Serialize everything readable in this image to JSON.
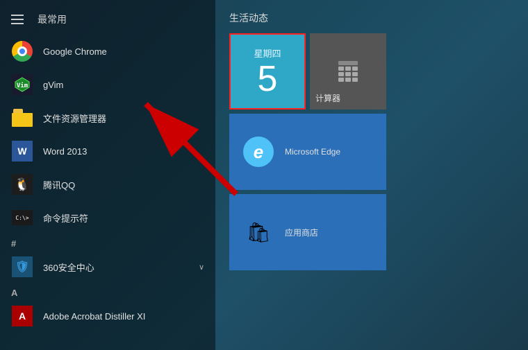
{
  "header": {
    "section_label": "最常用"
  },
  "right": {
    "title": "生活动态"
  },
  "apps": [
    {
      "id": "chrome",
      "label": "Google Chrome",
      "icon_type": "chrome"
    },
    {
      "id": "gvim",
      "label": "gVim",
      "icon_type": "gvim"
    },
    {
      "id": "file-explorer",
      "label": "文件资源管理器",
      "icon_type": "folder"
    },
    {
      "id": "word",
      "label": "Word 2013",
      "icon_type": "word"
    },
    {
      "id": "qq",
      "label": "腾讯QQ",
      "icon_type": "qq"
    },
    {
      "id": "cmd",
      "label": "命令提示符",
      "icon_type": "cmd"
    }
  ],
  "section_hash": "#",
  "apps_hash": [
    {
      "id": "360",
      "label": "360安全中心",
      "icon_type": "360",
      "has_expand": true
    }
  ],
  "section_a": "A",
  "apps_a": [
    {
      "id": "acrobat",
      "label": "Adobe Acrobat Distiller XI",
      "icon_type": "acrobat"
    }
  ],
  "tiles": {
    "calendar": {
      "day_name": "星期四",
      "day_number": "5"
    },
    "calc": {
      "label": "计算器"
    },
    "edge": {
      "label": "Microsoft Edge"
    },
    "store": {
      "label": "应用商店"
    }
  }
}
